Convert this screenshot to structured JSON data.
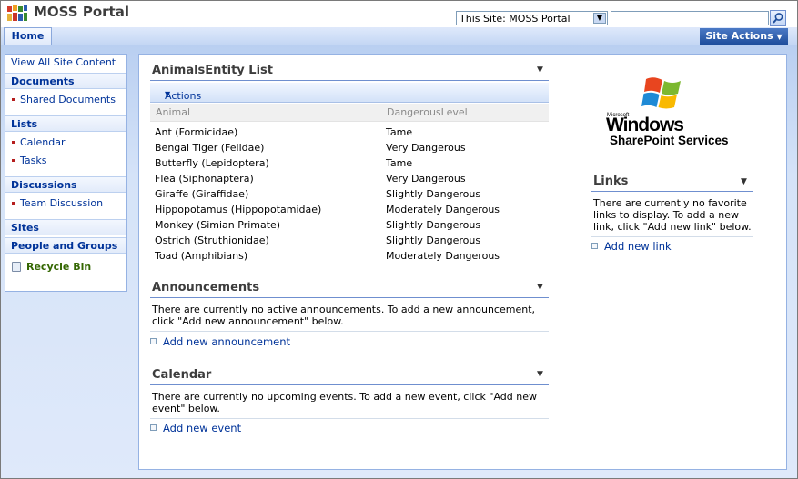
{
  "header": {
    "site_title": "MOSS Portal",
    "scope_selected": "This Site: MOSS Portal",
    "search_placeholder": "",
    "home_tab": "Home",
    "site_actions": "Site Actions"
  },
  "quick_launch": {
    "view_all": "View All Site Content",
    "documents": {
      "label": "Documents",
      "items": [
        "Shared Documents"
      ]
    },
    "lists": {
      "label": "Lists",
      "items": [
        "Calendar",
        "Tasks"
      ]
    },
    "discussions": {
      "label": "Discussions",
      "items": [
        "Team Discussion"
      ]
    },
    "sites": "Sites",
    "people": "People and Groups",
    "recycle": "Recycle Bin"
  },
  "animals_list": {
    "title": "AnimalsEntity List",
    "actions": "Actions",
    "columns": [
      "Animal",
      "DangerousLevel"
    ],
    "rows": [
      [
        "Ant (Formicidae)",
        "Tame"
      ],
      [
        "Bengal Tiger (Felidae)",
        "Very Dangerous"
      ],
      [
        "Butterfly (Lepidoptera)",
        "Tame"
      ],
      [
        "Flea (Siphonaptera)",
        "Very Dangerous"
      ],
      [
        "Giraffe (Giraffidae)",
        "Slightly Dangerous"
      ],
      [
        "Hippopotamus (Hippopotamidae)",
        "Moderately Dangerous"
      ],
      [
        "Monkey (Simian Primate)",
        "Slightly Dangerous"
      ],
      [
        "Ostrich (Struthionidae)",
        "Slightly Dangerous"
      ],
      [
        "Toad (Amphibians)",
        "Moderately Dangerous"
      ]
    ]
  },
  "announcements": {
    "title": "Announcements",
    "empty_text": "There are currently no active announcements. To add a new announcement, click \"Add new announcement\" below.",
    "add_link": "Add new announcement"
  },
  "calendar": {
    "title": "Calendar",
    "empty_text": "There are currently no upcoming events. To add a new event, click \"Add new event\" below.",
    "add_link": "Add new event"
  },
  "logo": {
    "microsoft": "Microsoft",
    "windows": "Windows",
    "product": "SharePoint Services"
  },
  "links": {
    "title": "Links",
    "empty_text": "There are currently no favorite links to display. To add a new link, click \"Add new link\" below.",
    "add_link": "Add new link"
  },
  "colors": {
    "link_blue": "#003399",
    "recycle_green": "#336600",
    "header_blue": "#1f4e9c"
  }
}
